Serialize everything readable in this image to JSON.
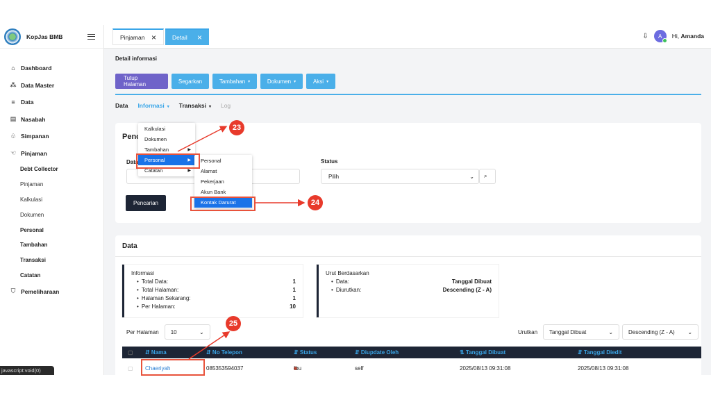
{
  "brand": {
    "name": "KopJas BMB"
  },
  "sidebar": {
    "items": [
      {
        "label": "Dashboard",
        "icon": "home-icon"
      },
      {
        "label": "Data Master",
        "icon": "sitemap-icon"
      },
      {
        "label": "Data",
        "icon": "sliders-icon"
      },
      {
        "label": "Nasabah",
        "icon": "id-card-icon"
      },
      {
        "label": "Simpanan",
        "icon": "piggy-bank-icon"
      },
      {
        "label": "Pinjaman",
        "icon": "hand-icon"
      }
    ],
    "sub_items": [
      "Debt Collector",
      "Pinjaman",
      "Kalkulasi",
      "Dokumen",
      "Personal",
      "Tambahan",
      "Transaksi",
      "Catatan"
    ],
    "maintenance": "Pemeliharaan"
  },
  "tabs": [
    {
      "label": "Pinjaman"
    },
    {
      "label": "Detail"
    }
  ],
  "user": {
    "avatar": "A",
    "greeting": "Hi,",
    "name": "Amanda"
  },
  "page": {
    "title": "Detail informasi"
  },
  "toolbar": {
    "close": "Tutup Halaman",
    "refresh": "Segarkan",
    "add": "Tambahan",
    "docs": "Dokumen",
    "action": "Aksi"
  },
  "subtabs": {
    "data": "Data",
    "info": "Informasi",
    "trans": "Transaksi",
    "log": "Log"
  },
  "search": {
    "title": "Penc",
    "date_label": "Data",
    "status_label": "Status",
    "status_value": "Pilih",
    "button": "Pencarian"
  },
  "menu1": [
    "Kalkulasi",
    "Dokumen",
    "Tambahan",
    "Personal",
    "Catatan"
  ],
  "menu2": [
    "Personal",
    "Alamat",
    "Pekerjaan",
    "Akun Bank",
    "Kontak Darurat"
  ],
  "data": {
    "title": "Data",
    "info": {
      "heading": "Informasi",
      "rows": [
        {
          "k": "Total Data:",
          "v": "1"
        },
        {
          "k": "Total Halaman:",
          "v": "1"
        },
        {
          "k": "Halaman Sekarang:",
          "v": "1"
        },
        {
          "k": "Per Halaman:",
          "v": "10"
        }
      ]
    },
    "sort": {
      "heading": "Urut Berdasarkan",
      "rows": [
        {
          "k": "Data:",
          "v": "Tanggal Dibuat"
        },
        {
          "k": "Diurutkan:",
          "v": "Descending (Z - A)"
        }
      ]
    },
    "per_page_label": "Per Halaman",
    "per_page_value": "10",
    "order_label": "Urutkan",
    "order_value": "Tanggal Dibuat",
    "direction_value": "Descending (Z - A)",
    "columns": [
      "⇵ Nama",
      "⇵ No Telepon",
      "⇵ Status",
      "⇵ Diupdate Oleh",
      "⇅ Tanggal Dibuat",
      "⇵ Tanggal Diedit"
    ],
    "rows": [
      {
        "nama": "Chaeriyah",
        "telepon": "085353594037",
        "status": "Ibu",
        "oleh": "self",
        "dibuat": "2025/08/13 09:31:08",
        "diedit": "2025/08/13 09:31:08"
      }
    ]
  },
  "annotations": [
    "23",
    "24",
    "25"
  ],
  "statusbar": "javascript:void(0)",
  "colors": {
    "accent": "#4aafe9",
    "purple": "#6f63c9",
    "dark": "#1d2535",
    "marker": "#e83a2b"
  }
}
